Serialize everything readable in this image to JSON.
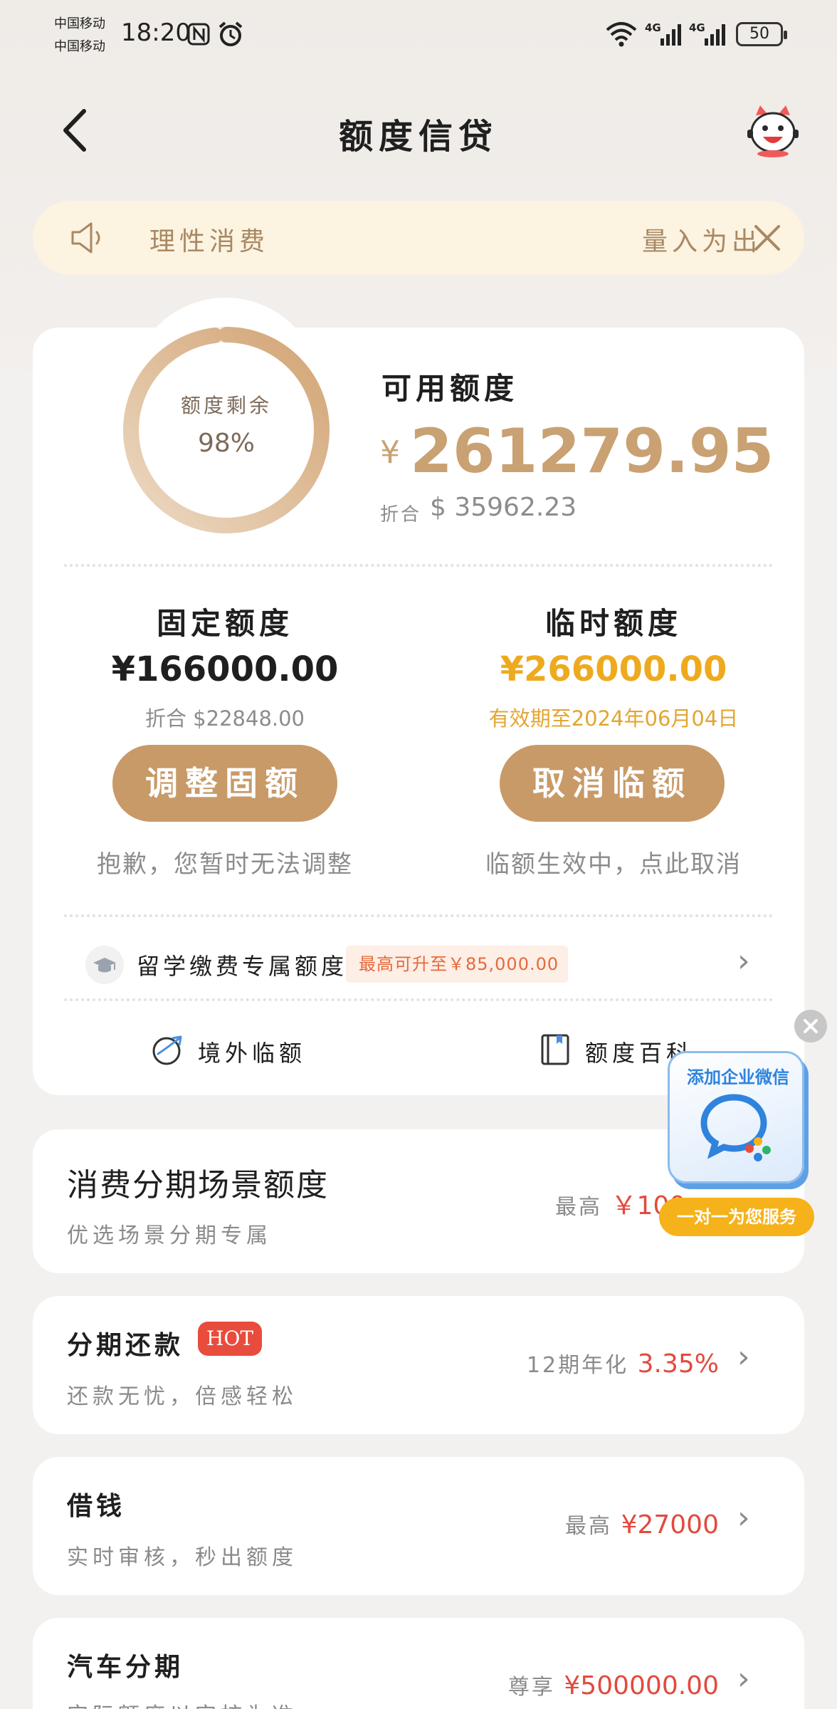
{
  "status_bar": {
    "carrier_1": "中国移动",
    "carrier_2": "中国移动",
    "time": "18:20",
    "battery": "50"
  },
  "header": {
    "title": "额度信贷"
  },
  "notice": {
    "text_left": "理性消费",
    "text_right": "量入为出"
  },
  "credit": {
    "ring_label": "额度剩余",
    "ring_percent": "98%",
    "ring_fraction": 0.98,
    "available_title": "可用额度",
    "currency_symbol": "¥",
    "available_amount": "261279.95",
    "converted_label": "折合",
    "converted_amount": "$ 35962.23",
    "fixed": {
      "title": "固定额度",
      "amount": "¥166000.00",
      "sub": "折合 $22848.00",
      "button": "调整固额",
      "note": "抱歉，您暂时无法调整"
    },
    "temporary": {
      "title": "临时额度",
      "amount": "¥266000.00",
      "sub": "有效期至2024年06月04日",
      "button": "取消临额",
      "note": "临额生效中，点此取消"
    },
    "study": {
      "label": "留学缴费专属额度",
      "badge": "最高可升至￥85,000.00"
    },
    "links": {
      "overseas": "境外临额",
      "encyclopedia": "额度百科"
    }
  },
  "cards": {
    "installment_scene": {
      "title": "消费分期场景额度",
      "sub": "优选场景分期专属",
      "right_label": "最高",
      "right_value": "￥100"
    },
    "installment_repay": {
      "title": "分期还款",
      "badge": "HOT",
      "sub": "还款无忧，倍感轻松",
      "right_label": "12期年化",
      "right_value": "3.35%"
    },
    "borrow": {
      "title": "借钱",
      "sub": "实时审核，秒出额度",
      "right_label": "最高",
      "right_value": "¥27000"
    },
    "car": {
      "title": "汽车分期",
      "sub": "实际额度以审核为准",
      "right_label": "尊享",
      "right_value": "¥500000.00"
    }
  },
  "float_widget": {
    "title": "添加企业微信",
    "pill": "一对一为您服务"
  },
  "colors": {
    "gold": "#c9a172",
    "button": "#c89a68",
    "temp_amount": "#eeaa1e",
    "red": "#e24a3e"
  }
}
